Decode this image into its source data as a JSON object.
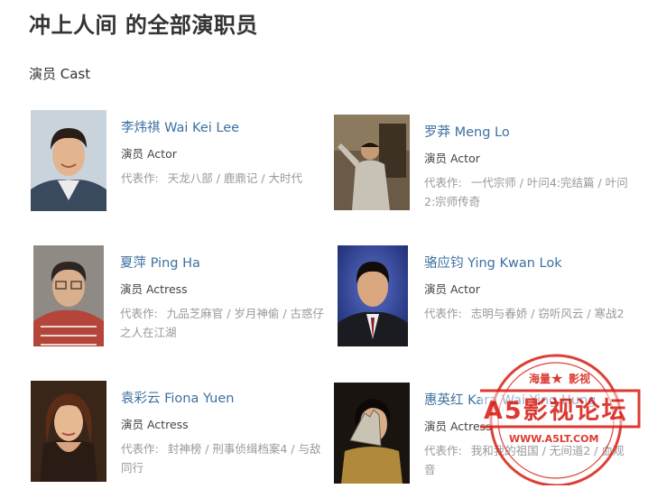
{
  "page": {
    "title": "冲上人间 的全部演职员",
    "section": "演员 Cast"
  },
  "cast": [
    {
      "name": "李炜祺 Wai Kei Lee",
      "role": "演员 Actor",
      "works_label": "代表作:",
      "works": "天龙八部 / 鹿鼎记 / 大时代"
    },
    {
      "name": "罗莽 Meng Lo",
      "role": "演员 Actor",
      "works_label": "代表作:",
      "works": "一代宗师 / 叶问4:完结篇 / 叶问2:宗师传奇"
    },
    {
      "name": "夏萍 Ping Ha",
      "role": "演员 Actress",
      "works_label": "代表作:",
      "works": "九品芝麻官 / 岁月神偷 / 古惑仔之人在江湖"
    },
    {
      "name": "骆应钧 Ying Kwan Lok",
      "role": "演员 Actor",
      "works_label": "代表作:",
      "works": "志明与春娇 / 窃听风云 / 寒战2"
    },
    {
      "name": "袁彩云 Fiona Yuen",
      "role": "演员 Actress",
      "works_label": "代表作:",
      "works": "封神榜 / 刑事侦缉档案4 / 与敌同行"
    },
    {
      "name": "惠英红 Kara Wai Ying Hung",
      "role": "演员 Actress",
      "works_label": "代表作:",
      "works": "我和我的祖国 / 无间道2 / 血观音"
    }
  ],
  "watermark": {
    "top_text": "海量 ★ 影视",
    "main_text": "A5影视论坛",
    "url": "WWW.A5LT.COM",
    "color": "#d9261c"
  }
}
